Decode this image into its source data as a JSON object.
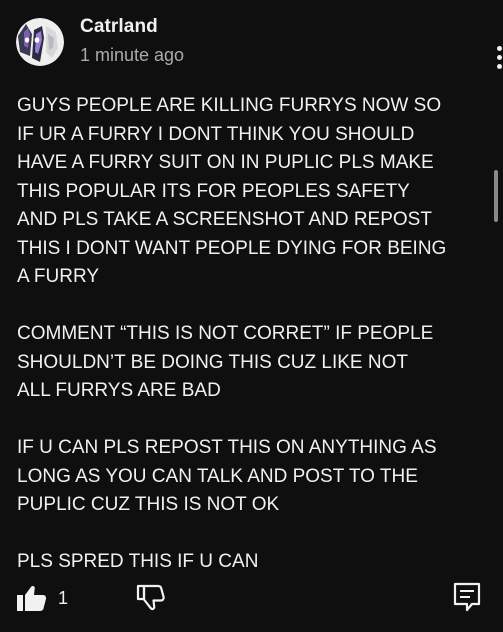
{
  "comment": {
    "author": "Catrland",
    "time": "1 minute ago",
    "paragraphs": [
      [
        "GUYS PEOPLE ARE KILLING FURRYS NOW SO",
        "IF UR A FURRY I DONT THINK YOU SHOULD",
        "HAVE A FURRY SUIT ON IN PUPLIC PLS MAKE",
        "THIS POPULAR ITS FOR PEOPLES SAFETY",
        "AND PLS TAKE A SCREENSHOT AND REPOST",
        "THIS I DONT WANT PEOPLE DYING FOR BEING",
        "A FURRY"
      ],
      [
        "COMMENT “THIS IS NOT CORRET” IF PEOPLE",
        "SHOULDN’T BE DOING THIS CUZ LIKE NOT",
        "ALL FURRYS ARE BAD"
      ],
      [
        "IF U CAN PLS REPOST THIS ON ANYTHING AS",
        "LONG AS YOU CAN TALK AND POST TO THE",
        "PUPLIC CUZ THIS IS NOT OK"
      ],
      [
        "PLS SPRED THIS IF U CAN"
      ]
    ]
  },
  "actions": {
    "like_count": "1",
    "icons": {
      "like": "thumbs-up-filled-icon",
      "dislike": "thumbs-down-outline-icon",
      "reply": "comment-reply-icon",
      "menu": "more-vertical-icon"
    }
  },
  "colors": {
    "background": "#0f0f0f",
    "text": "#f1f1f1",
    "secondary_text": "#aaaaaa"
  }
}
